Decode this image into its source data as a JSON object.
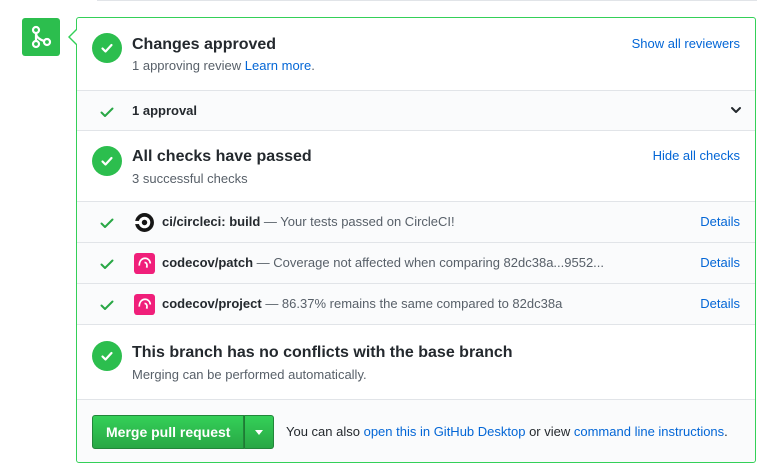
{
  "merge_status": {
    "approved": {
      "title": "Changes approved",
      "subtitle": "1 approving review",
      "learn_more": "Learn more",
      "subtitle_end": ".",
      "show_reviewers": "Show all reviewers"
    },
    "approvals_row": {
      "label": "1 approval"
    },
    "checks": {
      "title": "All checks have passed",
      "subtitle": "3 successful checks",
      "hide_link": "Hide all checks",
      "items": [
        {
          "name": "ci/circleci: build",
          "description": " — Your tests passed on CircleCI!",
          "details": "Details",
          "icon": "circleci-icon"
        },
        {
          "name": "codecov/patch",
          "description": " — Coverage not affected when comparing 82dc38a...9552...",
          "details": "Details",
          "icon": "codecov-icon"
        },
        {
          "name": "codecov/project",
          "description": " — 86.37% remains the same compared to 82dc38a",
          "details": "Details",
          "icon": "codecov-icon"
        }
      ]
    },
    "conflicts": {
      "title": "This branch has no conflicts with the base branch",
      "subtitle": "Merging can be performed automatically."
    },
    "merge": {
      "button_label": "Merge pull request",
      "note_prefix": "You can also ",
      "desktop_link": "open this in GitHub Desktop",
      "note_middle": " or view ",
      "cli_link": "command line instructions",
      "note_end": "."
    }
  },
  "colors": {
    "success": "#2cbe4e",
    "border_success": "#34d058",
    "link": "#0366d6",
    "codecov": "#f01f7a"
  }
}
